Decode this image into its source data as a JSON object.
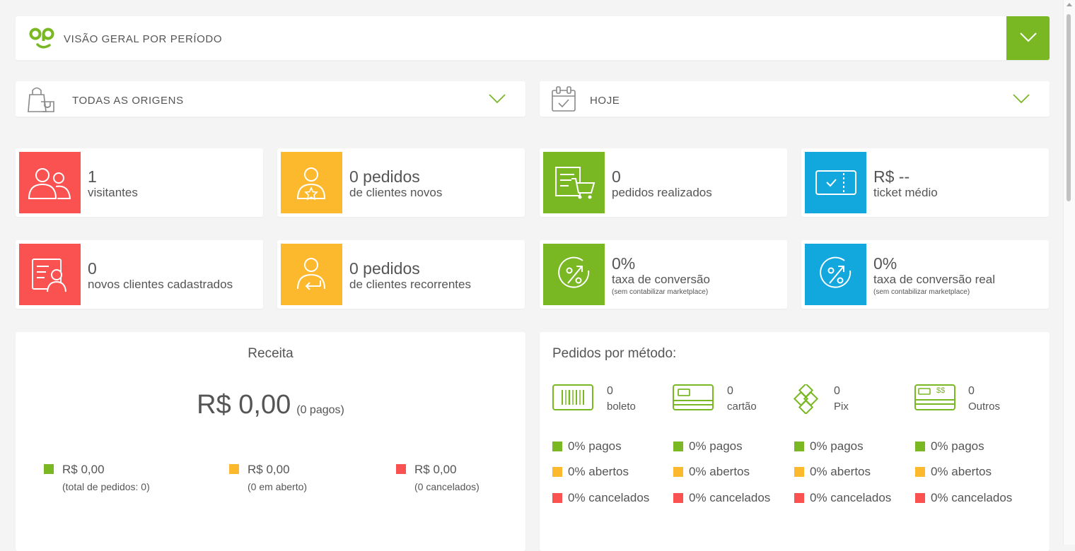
{
  "header": {
    "title": "VISÃO GERAL POR PERÍODO",
    "logo_icon": "op-logo-icon",
    "toggle_icon": "chevron-down-icon"
  },
  "filters": {
    "origin": {
      "label": "TODAS AS ORIGENS",
      "icon": "shopping-bags-icon"
    },
    "period": {
      "label": "HOJE",
      "icon": "calendar-check-icon"
    }
  },
  "stats": {
    "visitantes": {
      "value": "1",
      "label": "visitantes"
    },
    "clientes_novos": {
      "value": "0 pedidos",
      "label": "de clientes novos"
    },
    "pedidos_realizados": {
      "value": "0",
      "label": "pedidos realizados"
    },
    "ticket_medio": {
      "value": "R$ --",
      "label": "ticket médio"
    },
    "novos_clientes": {
      "value": "0",
      "label": "novos clientes cadastrados"
    },
    "clientes_recorrentes": {
      "value": "0 pedidos",
      "label": "de clientes recorrentes"
    },
    "taxa_conversao": {
      "value": "0%",
      "label": "taxa de conversão",
      "note": "(sem contabilizar marketplace)"
    },
    "taxa_conversao_real": {
      "value": "0%",
      "label": "taxa de conversão real",
      "note": "(sem contabilizar marketplace)"
    }
  },
  "receita": {
    "title": "Receita",
    "total": "R$ 0,00",
    "total_note": "(0 pagos)",
    "items": [
      {
        "value": "R$ 0,00",
        "note": "(total de pedidos: 0)"
      },
      {
        "value": "R$ 0,00",
        "note": "(0 em aberto)"
      },
      {
        "value": "R$ 0,00",
        "note": "(0 cancelados)"
      }
    ]
  },
  "metodos": {
    "title": "Pedidos por método:",
    "items": [
      {
        "count": "0",
        "label": "boleto",
        "icon": "barcode-icon",
        "pagos": "0% pagos",
        "abertos": "0% abertos",
        "cancelados": "0% cancelados"
      },
      {
        "count": "0",
        "label": "cartão",
        "icon": "credit-card-icon",
        "pagos": "0% pagos",
        "abertos": "0% abertos",
        "cancelados": "0% cancelados"
      },
      {
        "count": "0",
        "label": "Pix",
        "icon": "pix-icon",
        "pagos": "0% pagos",
        "abertos": "0% abertos",
        "cancelados": "0% cancelados"
      },
      {
        "count": "0",
        "label": "Outros",
        "icon": "cash-card-icon",
        "outros_mark": "$$",
        "pagos": "0% pagos",
        "abertos": "0% abertos",
        "cancelados": "0% cancelados"
      }
    ]
  },
  "colors": {
    "green": "#79b823",
    "yellow": "#fdb92e",
    "red": "#fa5151",
    "blue": "#12a7dd",
    "text": "#555555"
  }
}
